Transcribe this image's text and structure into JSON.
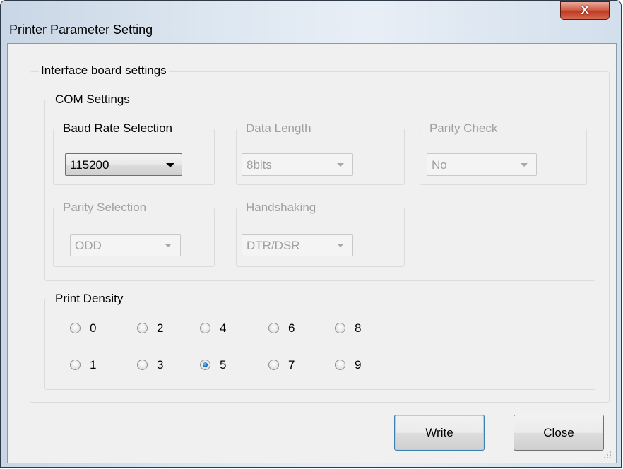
{
  "window": {
    "title": "Printer Parameter Setting",
    "close_glyph": "X"
  },
  "interface_group": {
    "label": "Interface board settings"
  },
  "com_group": {
    "label": "COM Settings"
  },
  "baud_rate": {
    "label": "Baud Rate Selection",
    "value": "115200",
    "enabled": true
  },
  "data_length": {
    "label": "Data Length",
    "value": "8bits",
    "enabled": false
  },
  "parity_check": {
    "label": "Parity Check",
    "value": "No",
    "enabled": false
  },
  "parity_selection": {
    "label": "Parity Selection",
    "value": "ODD",
    "enabled": false
  },
  "handshaking": {
    "label": "Handshaking",
    "value": "DTR/DSR",
    "enabled": false
  },
  "print_density": {
    "label": "Print Density",
    "options": [
      "0",
      "1",
      "2",
      "3",
      "4",
      "5",
      "6",
      "7",
      "8",
      "9"
    ],
    "selected": "5"
  },
  "buttons": {
    "write": "Write",
    "close": "Close"
  },
  "colors": {
    "close_button": "#c9432b",
    "selected_radio": "#1a6fc2",
    "disabled_text": "#a0a0a0"
  }
}
